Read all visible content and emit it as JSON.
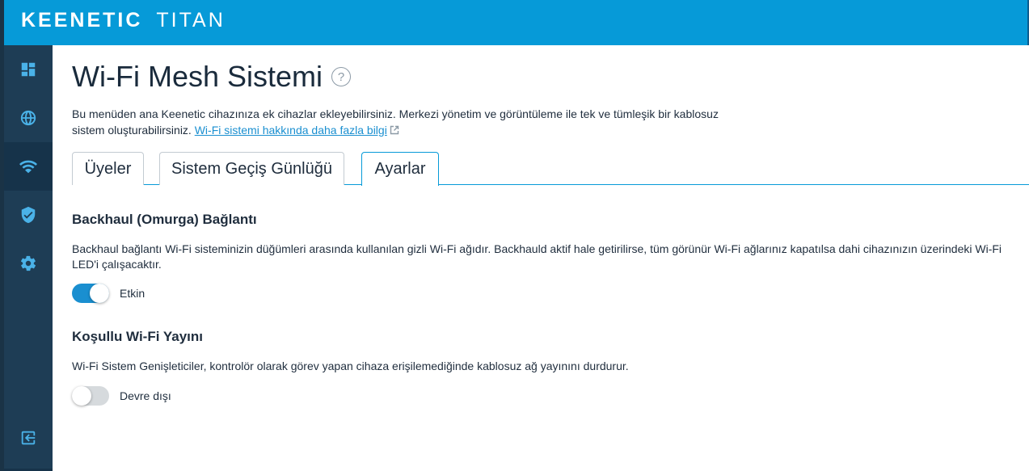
{
  "brand": {
    "part1": "KEENETIC",
    "part2": "TITAN"
  },
  "sidebar": {
    "items": [
      {
        "name": "dashboard-icon",
        "active": false
      },
      {
        "name": "globe-icon",
        "active": false
      },
      {
        "name": "wifi-icon",
        "active": true
      },
      {
        "name": "shield-check-icon",
        "active": false
      },
      {
        "name": "gear-icon",
        "active": false
      }
    ],
    "logout": {
      "name": "logout-icon"
    }
  },
  "page": {
    "title": "Wi-Fi Mesh Sistemi",
    "help": "?",
    "intro_text": "Bu menüden ana Keenetic cihazınıza ek cihazlar ekleyebilirsiniz. Merkezi yönetim ve görüntüleme ile tek ve tümleşik bir kablosuz sistem oluşturabilirsiniz.",
    "intro_link": "Wi-Fi sistemi hakkında daha fazla bilgi"
  },
  "tabs": [
    {
      "label": "Üyeler",
      "active": false
    },
    {
      "label": "Sistem Geçiş Günlüğü",
      "active": false
    },
    {
      "label": "Ayarlar",
      "active": true
    }
  ],
  "backhaul": {
    "title": "Backhaul (Omurga) Bağlantı",
    "description": "Backhaul bağlantı Wi-Fi sisteminizin düğümleri arasında kullanılan gizli Wi-Fi ağıdır. Backhauld aktif hale getirilirse, tüm görünür Wi-Fi ağlarınız kapatılsa dahi cihazınızın üzerindeki Wi-Fi LED'i çalışacaktır.",
    "toggle_state": "on",
    "toggle_label": "Etkin"
  },
  "conditional": {
    "title": "Koşullu Wi-Fi Yayını",
    "description": "Wi-Fi Sistem Genişleticiler, kontrolör olarak görev yapan cihaza erişilemediğinde kablosuz ağ yayınını durdurur.",
    "toggle_state": "off",
    "toggle_label": "Devre dışı"
  },
  "colors": {
    "header": "#069ad8",
    "sidebar": "#1e3d55",
    "accent": "#1a8fd0",
    "icon": "#4ab2e8"
  }
}
